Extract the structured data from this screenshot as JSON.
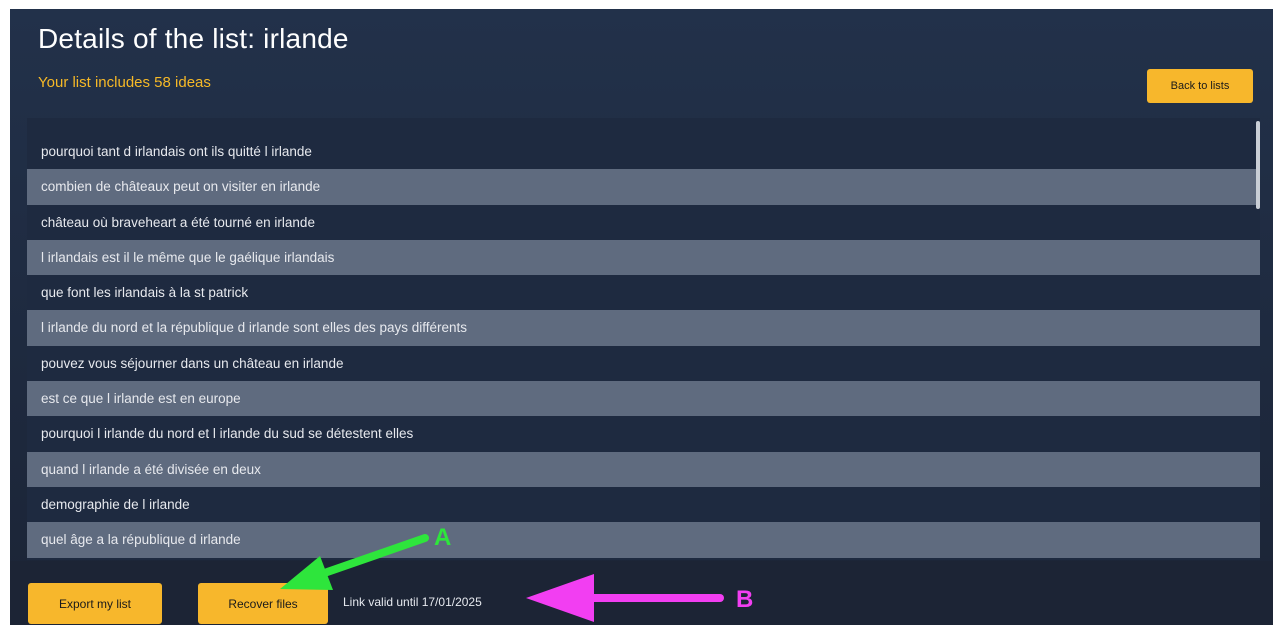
{
  "header": {
    "title": "Details of the list: irlande",
    "subtitle": "Your list includes 58 ideas",
    "back_label": "Back to lists"
  },
  "list": {
    "items": [
      "pourquoi tant d irlandais ont ils quitté l irlande",
      "combien de châteaux peut on visiter en irlande",
      "château où braveheart a été tourné en irlande",
      "l irlandais est il le même que le gaélique irlandais",
      "que font les irlandais à la st patrick",
      "l irlande du nord et la république d irlande sont elles des pays différents",
      "pouvez vous séjourner dans un château en irlande",
      "est ce que l irlande est en europe",
      "pourquoi l irlande du nord et l irlande du sud se détestent elles",
      "quand l irlande a été divisée en deux",
      "demographie de l irlande",
      "quel âge a la république d irlande"
    ]
  },
  "footer": {
    "export_label": "Export my list",
    "recover_label": "Recover files",
    "validity_text": "Link valid until 17/01/2025"
  },
  "annotations": {
    "a_label": "A",
    "b_label": "B",
    "a_color": "#2ee53c",
    "b_color": "#f23ef2"
  },
  "colors": {
    "accent": "#f7b72c",
    "background": "#1e2a40",
    "row_alt": "#5f6b7f"
  }
}
